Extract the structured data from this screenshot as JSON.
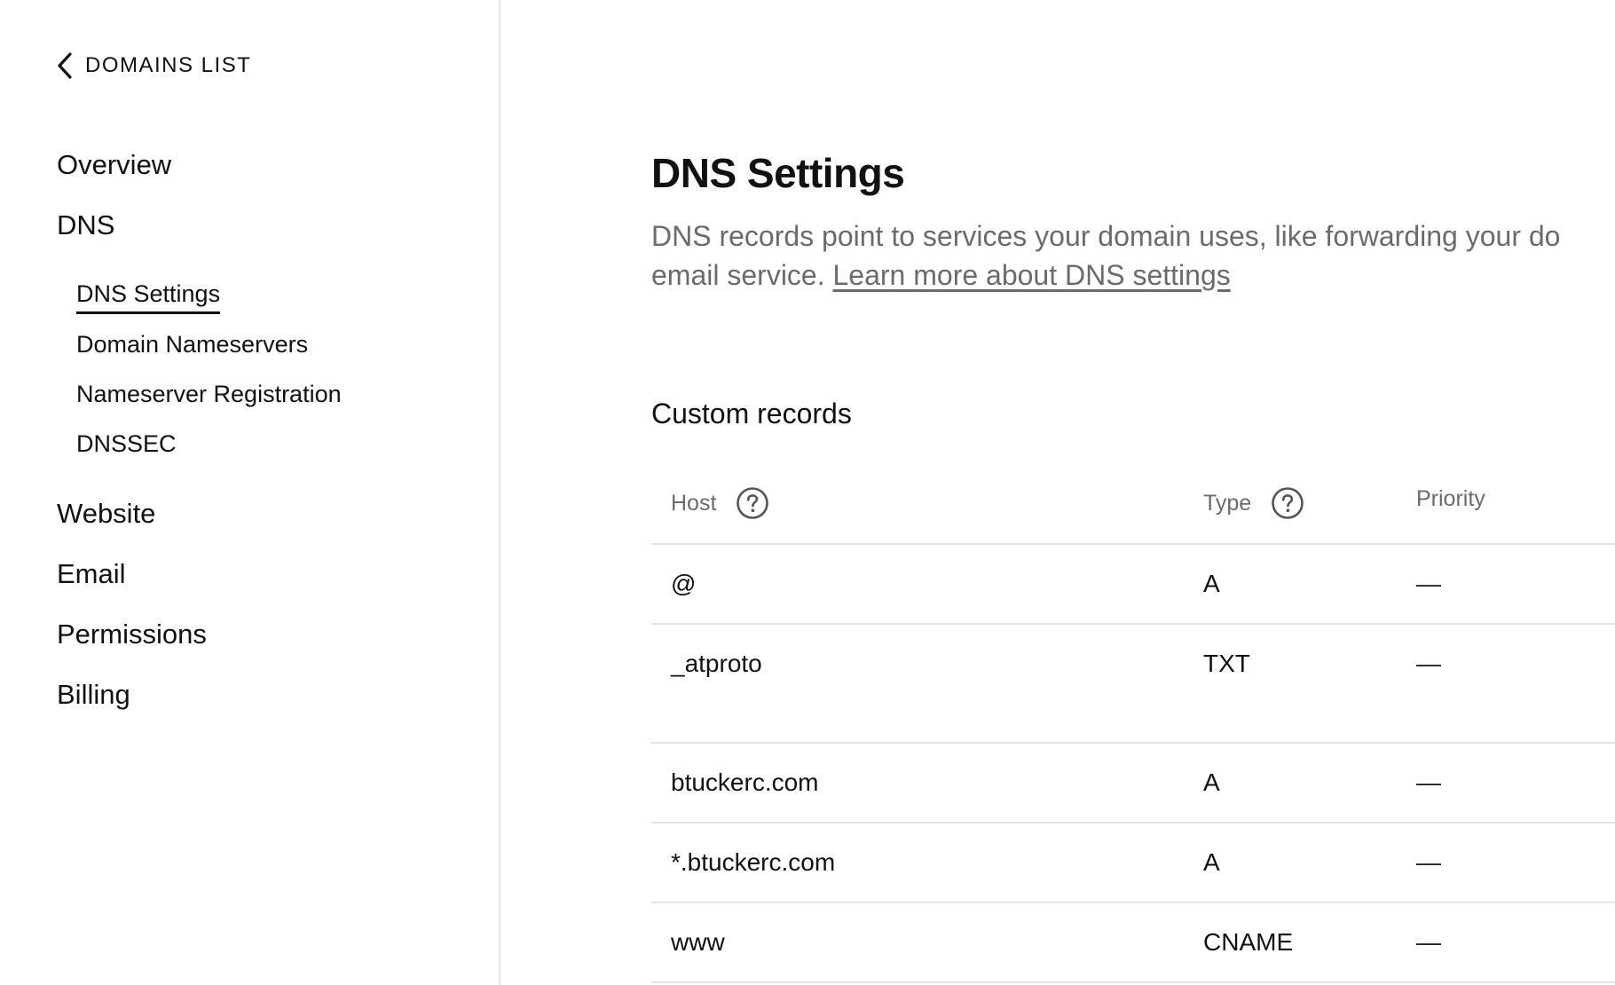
{
  "sidebar": {
    "back_label": "DOMAINS LIST",
    "nav": {
      "overview": "Overview",
      "dns": "DNS",
      "dns_sub": [
        "DNS Settings",
        "Domain Nameservers",
        "Nameserver Registration",
        "DNSSEC"
      ],
      "website": "Website",
      "email": "Email",
      "permissions": "Permissions",
      "billing": "Billing"
    }
  },
  "main": {
    "title": "DNS Settings",
    "description_line1": "DNS records point to services your domain uses, like forwarding your do",
    "description_line2": "email service.",
    "learn_more_link": "Learn more about DNS settings",
    "section_title": "Custom records",
    "table": {
      "headers": {
        "host": "Host",
        "type": "Type",
        "priority": "Priority"
      },
      "rows": [
        {
          "host": "@",
          "type": "A",
          "priority": "—"
        },
        {
          "host": "_atproto",
          "type": "TXT",
          "priority": "—"
        },
        {
          "host": "btuckerc.com",
          "type": "A",
          "priority": "—"
        },
        {
          "host": "*.btuckerc.com",
          "type": "A",
          "priority": "—"
        },
        {
          "host": "www",
          "type": "CNAME",
          "priority": "—"
        }
      ]
    }
  },
  "icons": {
    "back": "chevron-left-icon",
    "help": "help-circle-icon"
  }
}
